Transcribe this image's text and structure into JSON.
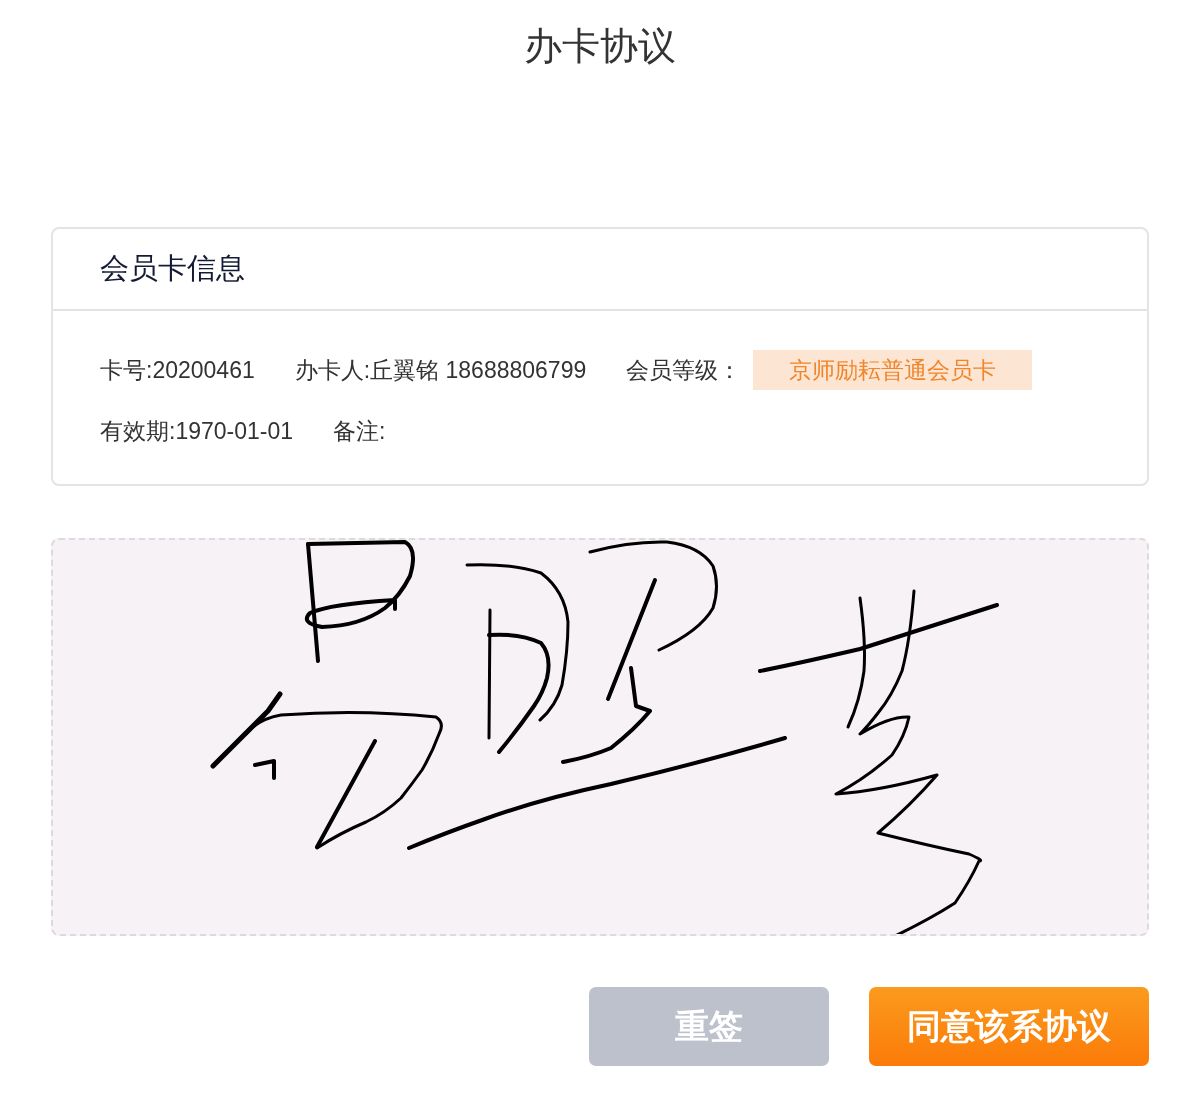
{
  "page": {
    "title": "办卡协议"
  },
  "card": {
    "title": "会员卡信息",
    "rows": [
      [
        {
          "kind": "text",
          "text": "卡号:20200461"
        },
        {
          "kind": "text",
          "text": "办卡人:丘翼铭 18688806799"
        },
        {
          "kind": "badge",
          "label": "会员等级：",
          "badge": "京师励耘普通会员卡"
        }
      ],
      [
        {
          "kind": "text",
          "text": "有效期:1970-01-01"
        },
        {
          "kind": "text",
          "text": "备注:"
        }
      ]
    ]
  },
  "signature": {
    "signed": true
  },
  "buttons": [
    {
      "kind": "secondary",
      "label": "重签"
    },
    {
      "kind": "primary",
      "label": "同意该系协议"
    }
  ]
}
